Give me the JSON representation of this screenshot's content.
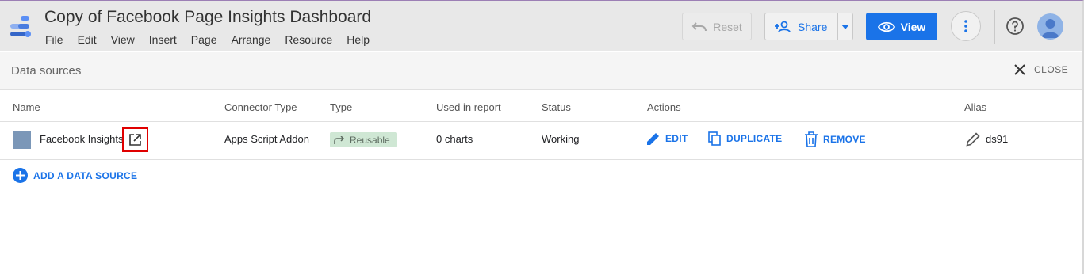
{
  "app": {
    "title": "Copy of Facebook Page Insights Dashboard",
    "logo_icon": "data-studio-logo-icon"
  },
  "menu": [
    "File",
    "Edit",
    "View",
    "Insert",
    "Page",
    "Arrange",
    "Resource",
    "Help"
  ],
  "toolbar": {
    "reset_label": "Reset",
    "share_label": "Share",
    "view_label": "View"
  },
  "panel": {
    "title": "Data sources",
    "close_label": "CLOSE"
  },
  "table": {
    "headers": [
      "Name",
      "Connector Type",
      "Type",
      "Used in report",
      "Status",
      "Actions",
      "Alias"
    ],
    "rows": [
      {
        "name": "Facebook Insights",
        "connector": "Apps Script Addon",
        "type": "Reusable",
        "used": "0 charts",
        "status": "Working",
        "actions": [
          "EDIT",
          "DUPLICATE",
          "REMOVE"
        ],
        "alias": "ds91"
      }
    ]
  },
  "add_source_label": "ADD A DATA SOURCE",
  "colors": {
    "accent": "#1a73e8",
    "highlight_box": "#e00000",
    "reusable_badge": "#cfe7d4",
    "datasource_swatch": "#7b97b8"
  }
}
